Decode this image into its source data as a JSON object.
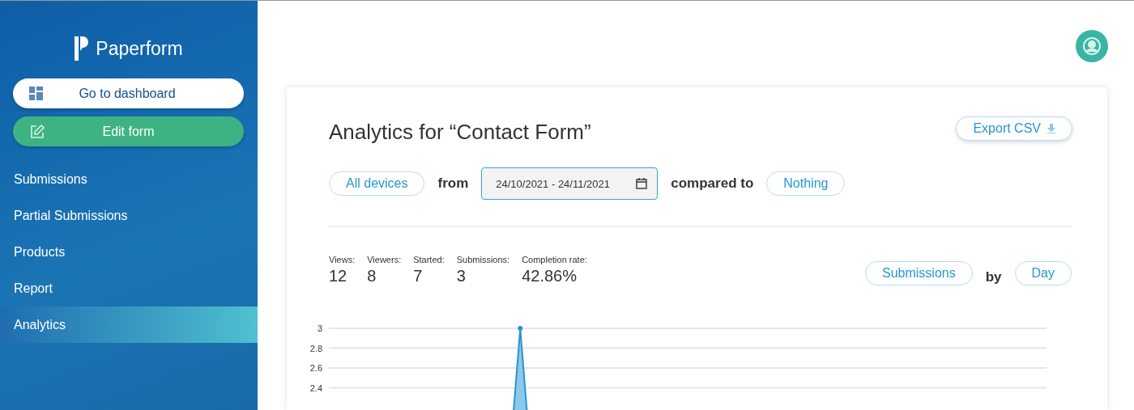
{
  "sidebar": {
    "brand": "Paperform",
    "buttons": [
      {
        "kind": "dashboard",
        "label": "Go to dashboard"
      },
      {
        "kind": "edit",
        "label": "Edit form"
      }
    ],
    "items": [
      {
        "label": "Submissions",
        "selected": false
      },
      {
        "label": "Partial Submissions",
        "selected": false
      },
      {
        "label": "Products",
        "selected": false
      },
      {
        "label": "Report",
        "selected": false
      },
      {
        "label": "Analytics",
        "selected": true
      }
    ]
  },
  "header": {
    "title": "Analytics for “Contact Form”",
    "export_button": "Export CSV"
  },
  "filters": {
    "device": "All devices",
    "from_label": "from",
    "date_range": "24/10/2021 - 24/11/2021",
    "compared_label": "compared to",
    "compare": "Nothing"
  },
  "stats": [
    {
      "label": "Views:",
      "value": "12"
    },
    {
      "label": "Viewers:",
      "value": "8"
    },
    {
      "label": "Started:",
      "value": "7"
    },
    {
      "label": "Submissions:",
      "value": "3"
    },
    {
      "label": "Completion rate:",
      "value": "42.86%"
    }
  ],
  "metric": {
    "measure": "Submissions",
    "by_label": "by",
    "period": "Day"
  },
  "chart_data": {
    "type": "area",
    "values": [
      0,
      0,
      0,
      0,
      0,
      0,
      0,
      0,
      3,
      0,
      0,
      0,
      0,
      0,
      0,
      0,
      0,
      0,
      0,
      0,
      0,
      0,
      0,
      0,
      0,
      0,
      0,
      0,
      0,
      0,
      0
    ],
    "ylim": [
      0,
      3
    ],
    "grid": true,
    "yticks": [
      2.4,
      2.6,
      2.8,
      3
    ]
  }
}
